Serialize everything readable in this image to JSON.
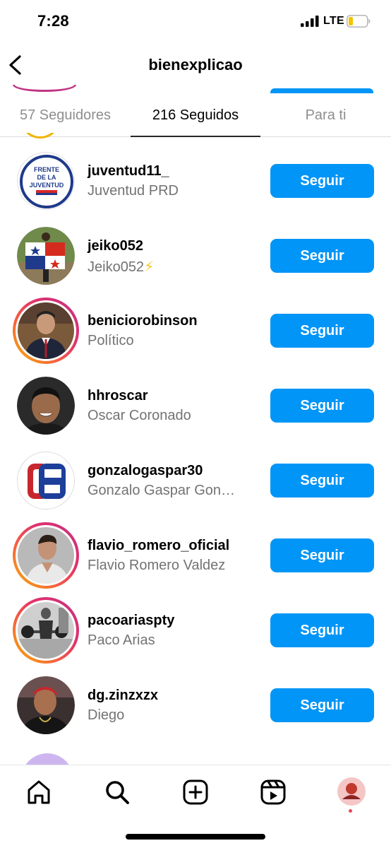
{
  "status_bar": {
    "time": "7:28",
    "network": "LTE"
  },
  "header": {
    "title": "bienexplicao"
  },
  "tabs": [
    {
      "label": "57 Seguidores"
    },
    {
      "label": "216 Seguidos"
    },
    {
      "label": "Para ti"
    }
  ],
  "active_tab": "216 Seguidos",
  "accounts": [
    {
      "username": "juventud11_",
      "name": "Juventud PRD",
      "button": "Seguir",
      "avatar_text": [
        "FRENTE",
        "DE LA",
        "JUVENTUD"
      ]
    },
    {
      "username": "jeiko052",
      "name": "Jeiko052",
      "badge_icon": "lightning-bolt-icon",
      "button": "Seguir"
    },
    {
      "username": "beniciorobinson",
      "name": "Político",
      "button": "Seguir"
    },
    {
      "username": "hhroscar",
      "name": "Oscar Coronado",
      "button": "Seguir"
    },
    {
      "username": "gonzalogaspar30",
      "name": "Gonzalo Gaspar Gon…",
      "button": "Seguir"
    },
    {
      "username": "flavio_romero_oficial",
      "name": "Flavio Romero Valdez",
      "button": "Seguir"
    },
    {
      "username": "pacoariaspty",
      "name": "Paco Arias",
      "button": "Seguir"
    },
    {
      "username": "dg.zinzxzx",
      "name": "Diego",
      "button": "Seguir"
    }
  ],
  "tab_bar": {
    "icons": [
      "home-icon",
      "search-icon",
      "create-icon",
      "reels-icon",
      "profile-avatar"
    ]
  },
  "colors": {
    "follow_button": "#0095f6",
    "secondary_text": "#737373",
    "story_ring": "#e1306c"
  }
}
